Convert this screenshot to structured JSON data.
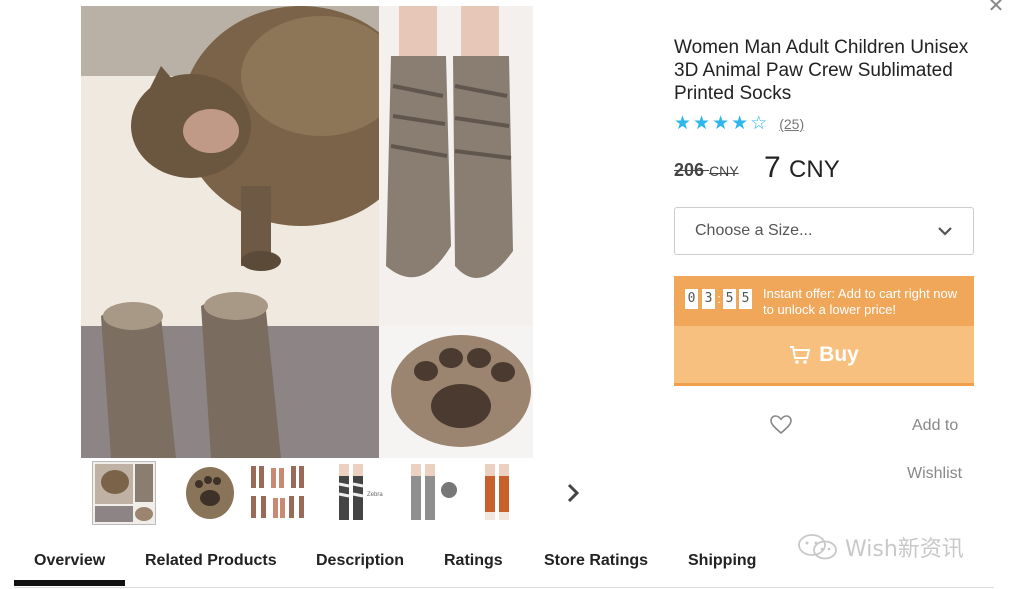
{
  "product": {
    "title": "Women Man Adult Children Unisex 3D Animal Paw Crew Sublimated Printed Socks",
    "rating_stars": 4,
    "review_count": "(25)",
    "old_price": "206",
    "old_currency": "CNY",
    "new_price": "7",
    "new_currency": "CNY",
    "image_icon": "cat-paw-socks-photo"
  },
  "size_select": {
    "placeholder": "Choose a Size..."
  },
  "offer": {
    "timer_digits": [
      "0",
      "3",
      "5",
      "5"
    ],
    "text": "Instant offer: Add to cart right now to unlock a lower price!"
  },
  "buy_button": {
    "label": "Buy",
    "icon": "cart-icon"
  },
  "wishlist": {
    "line1": "Add to",
    "line2": "Wishlist",
    "icon": "heart-icon"
  },
  "tabs": [
    {
      "label": "Overview",
      "active": true
    },
    {
      "label": "Related Products"
    },
    {
      "label": "Description"
    },
    {
      "label": "Ratings"
    },
    {
      "label": "Store Ratings"
    },
    {
      "label": "Shipping"
    }
  ],
  "watermark": {
    "text": "Wish新资讯"
  },
  "colors": {
    "star": "#2fb7ec",
    "offer_bg": "#f0a75a",
    "buy_bg": "#f8c07f",
    "tab_active": "#111111"
  }
}
